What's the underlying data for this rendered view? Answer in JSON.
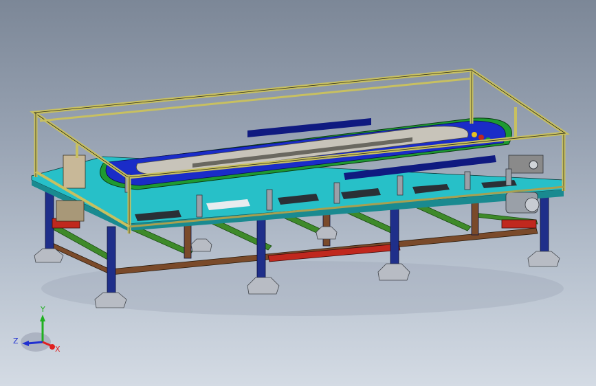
{
  "viewport": {
    "background_top": "#7c8797",
    "background_bottom": "#d4dbe4"
  },
  "model": {
    "colors": {
      "frame_aluminum": "#8a8a6a",
      "frame_outline": "#2a2a1a",
      "leg_blue": "#1f2f8a",
      "table_cyan": "#27c0c8",
      "cross_brace_green": "#3e8a2a",
      "red_rail": "#c0281e",
      "belt_blue": "#1a2cc8",
      "belt_green": "#1e9a32",
      "track_plate": "#c8c4ba",
      "base_foot": "#b8bcc4",
      "motor_grey": "#9aa0a8",
      "brown_bar": "#7a4a2a"
    }
  },
  "triad": {
    "x_label": "X",
    "y_label": "Y",
    "z_label": "Z",
    "x_color": "#e02020",
    "y_color": "#20b020",
    "z_color": "#2030d0"
  }
}
